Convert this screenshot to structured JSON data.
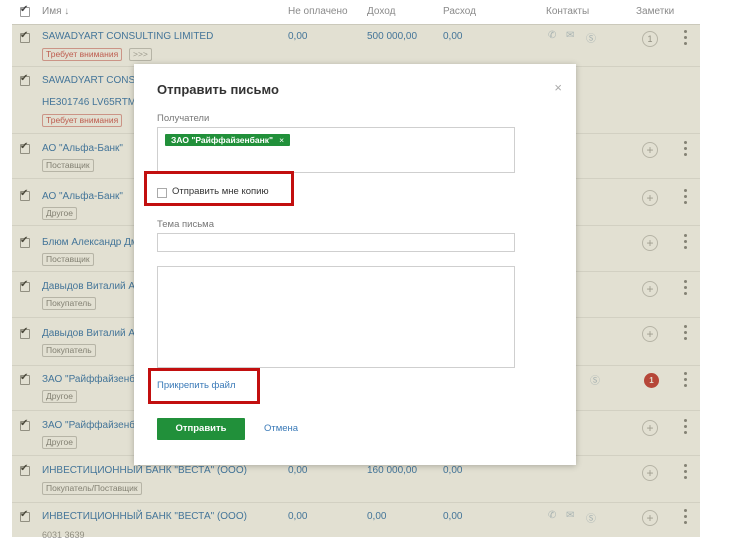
{
  "header": {
    "name": "Имя ↓",
    "unpaid": "Не оплачено",
    "income": "Доход",
    "expense": "Расход",
    "contacts": "Контакты",
    "notes": "Заметки"
  },
  "rows": [
    {
      "name": "SAWADYART CONSULTING LIMITED",
      "tag": "Требует внимания",
      "more": ">>>",
      "unpaid": "0,00",
      "income": "500 000,00",
      "expense": "0,00",
      "note": "1"
    },
    {
      "name": "SAWADYART CONSU",
      "name2": "HE301746 LV65RTMB",
      "tag": "Требует внимания"
    },
    {
      "name": "АО \"Альфа-Банк\"",
      "tag": "Поставщик"
    },
    {
      "name": "АО \"Альфа-Банк\"",
      "tag": "Другое"
    },
    {
      "name": "Блюм Александр Дм",
      "tag": "Поставщик"
    },
    {
      "name": "Давыдов Виталий Ан",
      "tag": "Покупатель"
    },
    {
      "name": "Давыдов Виталий Ан",
      "tag": "Покупатель"
    },
    {
      "name": "ЗАО \"Райффайзенба",
      "tag": "Другое",
      "badge": "1"
    },
    {
      "name": "ЗАО \"Райффайзенба",
      "tag": "Другое"
    },
    {
      "name": "ИНВЕСТИЦИОННЫЙ БАНК \"ВЕСТА\" (ООО)",
      "tag": "Покупатель/Поставщик",
      "unpaid": "0,00",
      "income": "160 000,00",
      "expense": "0,00"
    },
    {
      "name": "ИНВЕСТИЦИОННЫЙ БАНК \"ВЕСТА\" (ООО)",
      "name2": "6031 3639",
      "unpaid": "0,00",
      "income": "0,00",
      "expense": "0,00"
    }
  ],
  "modal": {
    "title": "Отправить письмо",
    "close": "×",
    "recipients_label": "Получатели",
    "recipient_chip": "ЗАО \"Райффайзенбанк\"",
    "chip_remove": "×",
    "copy_label": "Отправить мне копию",
    "subject_label": "Тема письма",
    "attach_link": "Прикрепить файл",
    "send_button": "Отправить",
    "cancel_link": "Отмена"
  },
  "icons": {
    "phone": "phone-icon",
    "mail": "mail-icon",
    "skype": "skype-icon",
    "plus": "add-note-icon",
    "dots": "more-vertical-icon"
  },
  "colors": {
    "accent_green": "#21903a",
    "link_blue": "#3a7ab8",
    "warning_red": "#d25b5b",
    "highlight_red": "#c20f0f"
  }
}
